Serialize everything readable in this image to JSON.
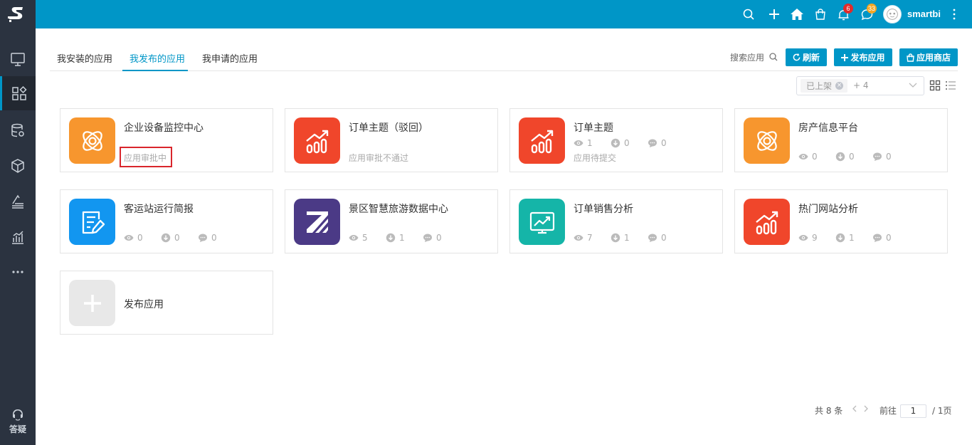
{
  "brand": {
    "accent": "#0096c7",
    "sidebar_bg": "#2b3340"
  },
  "sidebar": {
    "items": [
      {
        "icon": "monitor-icon"
      },
      {
        "icon": "apps-icon",
        "active": true
      },
      {
        "icon": "database-settings-icon"
      },
      {
        "icon": "cube-icon"
      },
      {
        "icon": "stack-layers-icon"
      },
      {
        "icon": "bar-chart-icon"
      },
      {
        "icon": "more-horizontal-icon"
      }
    ],
    "help_label": "答疑"
  },
  "topbar": {
    "notifications_count": "6",
    "messages_count": "33",
    "username": "smartbi"
  },
  "tabs": [
    {
      "label": "我安装的应用"
    },
    {
      "label": "我发布的应用",
      "active": true
    },
    {
      "label": "我申请的应用"
    }
  ],
  "toolbar": {
    "search_label": "搜索应用",
    "refresh_label": "刷新",
    "publish_label": "发布应用",
    "store_label": "应用商店"
  },
  "filter": {
    "chip": "已上架",
    "more": "+ 4"
  },
  "cards": [
    {
      "title": "企业设备监控中心",
      "status": "应用审批中",
      "color": "#f7962e",
      "icon": "atom-gear-icon"
    },
    {
      "title": "订单主题（驳回）",
      "status": "应用审批不通过",
      "color": "#f0462b",
      "icon": "growth-chart-icon"
    },
    {
      "title": "订单主题",
      "status": "应用待提交",
      "color": "#f0462b",
      "icon": "growth-chart-icon",
      "views": "1",
      "downloads": "0",
      "comments": "0"
    },
    {
      "title": "房产信息平台",
      "color": "#f7962e",
      "icon": "atom-gear-icon",
      "views": "0",
      "downloads": "0",
      "comments": "0"
    },
    {
      "title": "客运站运行简报",
      "color": "#1296f0",
      "icon": "report-edit-icon",
      "views": "0",
      "downloads": "0",
      "comments": "0"
    },
    {
      "title": "景区智慧旅游数据中心",
      "color": "#4b3a86",
      "icon": "stripe-z-icon",
      "views": "5",
      "downloads": "1",
      "comments": "0"
    },
    {
      "title": "订单销售分析",
      "color": "#15b5a8",
      "icon": "trend-board-icon",
      "views": "7",
      "downloads": "1",
      "comments": "0"
    },
    {
      "title": "热门网站分析",
      "color": "#f0462b",
      "icon": "growth-chart-icon",
      "views": "9",
      "downloads": "1",
      "comments": "0"
    }
  ],
  "add_card": {
    "label": "发布应用"
  },
  "pagination": {
    "total": "共 8 条",
    "goto_label": "前往",
    "page": "1",
    "pages": "/ 1页"
  }
}
